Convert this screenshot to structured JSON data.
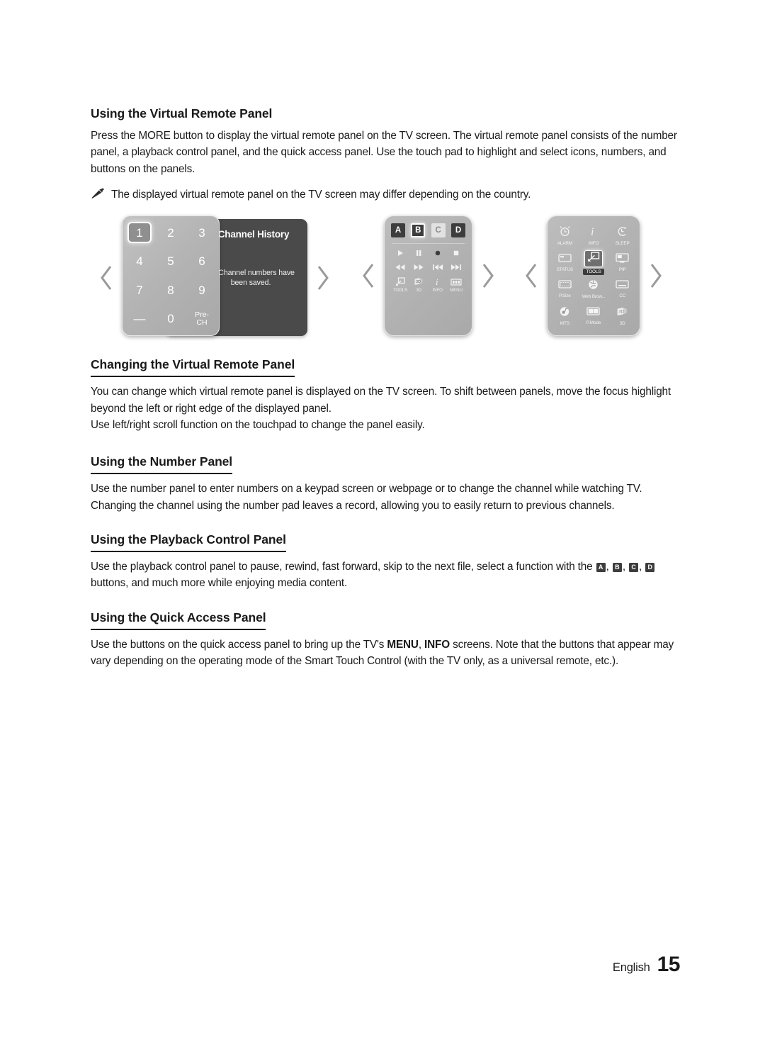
{
  "sections": [
    {
      "id": "using-virtual-remote-panel",
      "heading": "Using the Virtual Remote Panel",
      "ruled": false,
      "paragraphs": [
        "Press the MORE button to display the virtual remote panel on the TV screen. The virtual remote panel consists of the number panel, a playback control panel, and the quick access panel. Use the touch pad to highlight and select icons, numbers, and buttons on the panels."
      ],
      "note": "The displayed virtual remote panel on the TV screen may differ depending on the country."
    },
    {
      "id": "changing-virtual-remote-panel",
      "heading": "Changing the Virtual Remote Panel",
      "ruled": true,
      "paragraphs": [
        "You can change which virtual remote panel is displayed on the TV screen. To shift between panels, move the focus highlight beyond the left or right edge of the displayed panel.",
        "Use left/right scroll function on the touchpad to change the panel easily."
      ]
    },
    {
      "id": "using-number-panel",
      "heading": "Using the Number Panel",
      "ruled": true,
      "paragraphs": [
        "Use the number panel to enter numbers on a keypad screen or webpage or to change the channel while watching TV. Changing the channel using the number pad leaves a record, allowing you to easily return to previous channels."
      ]
    },
    {
      "id": "using-playback-control-panel",
      "heading": "Using the Playback Control Panel",
      "ruled": true
    },
    {
      "id": "using-quick-access-panel",
      "heading": "Using the Quick Access Panel",
      "ruled": true
    }
  ],
  "playback_paragraph": {
    "before": "Use the playback control panel to pause, rewind, fast forward, skip to the next file, select a function with the ",
    "badges": [
      "A",
      "B",
      "C",
      "D"
    ],
    "after": " buttons, and much more while enjoying media content."
  },
  "quick_access_paragraph": {
    "before": "Use the buttons on the quick access panel to bring up the TV's ",
    "strong1": "MENU",
    "between": ", ",
    "strong2": "INFO",
    "after": " screens. Note that the buttons that appear may vary depending on the operating mode of the Smart Touch Control (with the TV only, as a universal remote, etc.)."
  },
  "figures": {
    "number_panel": {
      "keys": [
        "1",
        "2",
        "3",
        "4",
        "5",
        "6",
        "7",
        "8",
        "9",
        "—",
        "0",
        "Pre-\nCH"
      ],
      "selected_key": "1",
      "history_title": "Channel History",
      "history_message": "No Channel numbers have been saved.",
      "nav_left": "chevron-left-icon",
      "nav_right": "chevron-right-icon"
    },
    "playback_panel": {
      "color_buttons": [
        {
          "label": "A",
          "style": "dark"
        },
        {
          "label": "B",
          "style": "selected"
        },
        {
          "label": "C",
          "style": "light"
        },
        {
          "label": "D",
          "style": "dark"
        }
      ],
      "transport_row1": [
        "play-icon",
        "pause-icon",
        "record-icon",
        "stop-icon"
      ],
      "transport_row2": [
        "rewind-icon",
        "fast-forward-icon",
        "previous-icon",
        "next-icon"
      ],
      "function_buttons": [
        {
          "label": "TOOLS",
          "icon": "tools-icon"
        },
        {
          "label": "3D",
          "icon": "three-d-icon"
        },
        {
          "label": "INFO",
          "icon": "info-icon"
        },
        {
          "label": "MENU",
          "icon": "menu-icon"
        }
      ]
    },
    "quick_access_panel": {
      "buttons": [
        {
          "label": "ALARM",
          "icon": "alarm-clock-icon",
          "selected": false
        },
        {
          "label": "INFO",
          "icon": "info-icon",
          "selected": false
        },
        {
          "label": "SLEEP",
          "icon": "sleep-timer-icon",
          "selected": false
        },
        {
          "label": "STATUS",
          "icon": "status-icon",
          "selected": false
        },
        {
          "label": "TOOLS",
          "icon": "tools-icon",
          "selected": true
        },
        {
          "label": "PIP",
          "icon": "pip-icon",
          "selected": false
        },
        {
          "label": "P.Size",
          "icon": "picture-size-icon",
          "selected": false
        },
        {
          "label": "Web Brow...",
          "icon": "web-browser-icon",
          "selected": false
        },
        {
          "label": "CC",
          "icon": "closed-caption-icon",
          "selected": false
        },
        {
          "label": "MTS",
          "icon": "mts-audio-icon",
          "selected": false
        },
        {
          "label": "P.Mode",
          "icon": "picture-mode-icon",
          "selected": false
        },
        {
          "label": "3D",
          "icon": "three-d-icon",
          "selected": false
        }
      ]
    }
  },
  "footer": {
    "language": "English",
    "page_number": "15"
  }
}
